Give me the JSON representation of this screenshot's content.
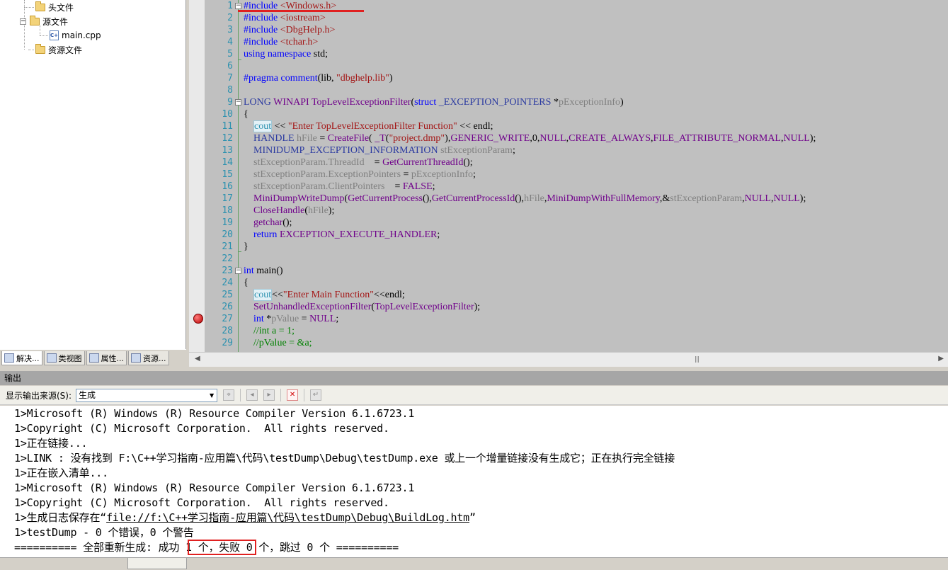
{
  "solution_explorer": {
    "items": [
      {
        "label": "头文件",
        "icon": "folder-icon"
      },
      {
        "label": "源文件",
        "icon": "folder-icon"
      },
      {
        "label": "main.cpp",
        "icon": "cpp-file-icon"
      },
      {
        "label": "资源文件",
        "icon": "folder-icon"
      }
    ],
    "tabs": [
      {
        "label": "解决..."
      },
      {
        "label": "类视图"
      },
      {
        "label": "属性..."
      },
      {
        "label": "资源..."
      }
    ]
  },
  "editor": {
    "line_numbers": [
      "1",
      "2",
      "3",
      "4",
      "5",
      "6",
      "7",
      "8",
      "9",
      "10",
      "11",
      "12",
      "13",
      "14",
      "15",
      "16",
      "17",
      "18",
      "19",
      "20",
      "21",
      "22",
      "23",
      "24",
      "25",
      "26",
      "27",
      "28",
      "29"
    ],
    "breakpoint_line": "27"
  },
  "output": {
    "title": "输出",
    "source_label": "显示输出来源(S):",
    "source_value": "生成",
    "lines": [
      "1>Microsoft (R) Windows (R) Resource Compiler Version 6.1.6723.1",
      "1>Copyright (C) Microsoft Corporation.  All rights reserved.",
      "1>正在链接...",
      "1>LINK : 没有找到 F:\\C++学习指南-应用篇\\代码\\testDump\\Debug\\testDump.exe 或上一个增量链接没有生成它；正在执行完全链接",
      "1>正在嵌入清单...",
      "1>Microsoft (R) Windows (R) Resource Compiler Version 6.1.6723.1",
      "1>Copyright (C) Microsoft Corporation.  All rights reserved."
    ],
    "buildlog_prefix": "1>生成日志保存在“",
    "buildlog_link": "file://f:\\C++学习指南-应用篇\\代码\\testDump\\Debug\\BuildLog.htm",
    "buildlog_suffix": "”",
    "summary_line": "1>testDump - 0 个错误，0 个警告",
    "final_line": "========== 全部重新生成: 成功 1 个，失败 0 个，跳过 0 个 =========="
  }
}
